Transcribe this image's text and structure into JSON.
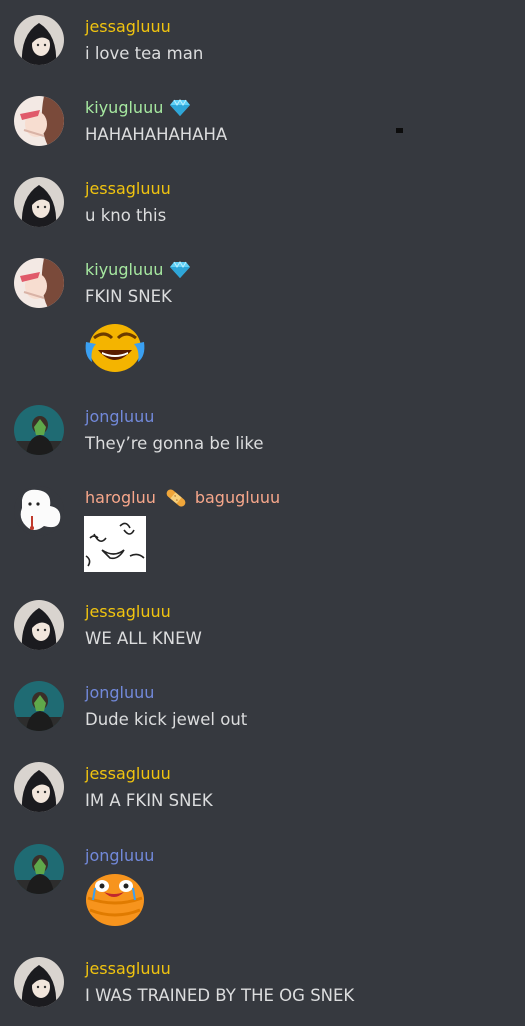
{
  "messages": [
    {
      "user": "jessagluuu",
      "text": "i love tea man"
    },
    {
      "user": "kiyugluuu",
      "text": "HAHAHAHAHAHA"
    },
    {
      "user": "jessagluuu",
      "text": "u kno this"
    },
    {
      "user": "kiyugluuu",
      "text": "FKIN SNEK"
    },
    {
      "user": "jongluuu",
      "text": "They’re gonna be like"
    },
    {
      "user": "harogluu",
      "user2": "bagugluuu",
      "text": ""
    },
    {
      "user": "jessagluuu",
      "text": "WE ALL KNEW"
    },
    {
      "user": "jongluuu",
      "text": "Dude kick jewel out"
    },
    {
      "user": "jessagluuu",
      "text": "IM A FKIN SNEK"
    },
    {
      "user": "jongluuu",
      "text": ""
    },
    {
      "user": "jessagluuu",
      "text": "I WAS TRAINED BY THE OG SNEK"
    }
  ],
  "icons": {
    "nitro_badge": "gem-icon",
    "separator": "bandage-icon"
  },
  "colors": {
    "background": "#36393f",
    "text": "#dcddde",
    "jessagluuu": "#f1c40f",
    "kiyugluuu": "#a6e8a0",
    "jongluuu": "#7289da",
    "harogluu": "#f7a78b"
  }
}
